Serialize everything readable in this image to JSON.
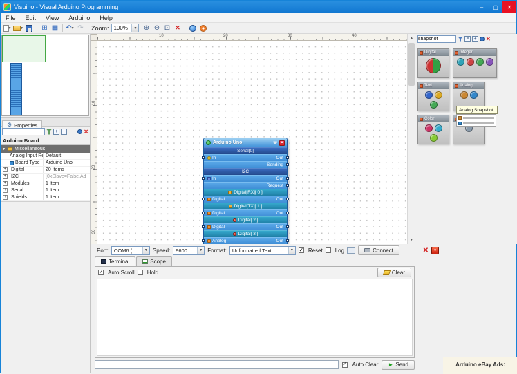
{
  "window": {
    "title": "Visuino - Visual Arduino Programming",
    "menu": [
      "File",
      "Edit",
      "View",
      "Arduino",
      "Help"
    ],
    "controls": {
      "minimize": "–",
      "maximize": "▢",
      "close": "✕"
    }
  },
  "toolbar": {
    "zoom_label": "Zoom:",
    "zoom_value": "100%"
  },
  "left_panel": {
    "properties_tab": "Properties",
    "board_title": "Arduino Board",
    "root_item": "Miscellaneous",
    "rows": [
      {
        "name": "Analog Input Refe.",
        "value": "Default"
      },
      {
        "name": "Board Type",
        "value": "Arduino Uno",
        "icon": "chip"
      },
      {
        "name": "Digital",
        "value": "20 Items",
        "expand": true
      },
      {
        "name": "I2C",
        "value": "[0xSlave=False,Ad",
        "expand": true,
        "muted": true
      },
      {
        "name": "Modules",
        "value": "1 Item",
        "expand": true
      },
      {
        "name": "Serial",
        "value": "1 Item",
        "expand": true
      },
      {
        "name": "Shields",
        "value": "1 Item",
        "expand": true
      }
    ]
  },
  "canvas": {
    "ruler_h": [
      "10",
      "20",
      "30",
      "40"
    ],
    "ruler_v": [
      "10",
      "20",
      "30"
    ],
    "component": {
      "title": "Arduino Uno",
      "rows": [
        {
          "type": "section",
          "text": "Serial[0]"
        },
        {
          "type": "pins",
          "left": "In",
          "right": "Out",
          "left_icon": "serial"
        },
        {
          "type": "pins",
          "right": "Sending"
        },
        {
          "type": "section",
          "text": "I2C"
        },
        {
          "type": "pins",
          "left": "In",
          "right": "Out",
          "left_icon": "i2c"
        },
        {
          "type": "pins",
          "right": "Request"
        },
        {
          "type": "channel",
          "text": "Digital[RX][ 0 ]",
          "icon": "chip"
        },
        {
          "type": "pins",
          "left": "Digital",
          "right": "Out",
          "left_icon": "digital"
        },
        {
          "type": "channel",
          "text": "Digital[TX][ 1 ]",
          "icon": "chip"
        },
        {
          "type": "pins",
          "left": "Digital",
          "right": "Out",
          "left_icon": "digital"
        },
        {
          "type": "channel",
          "text": "Digital[ 2 ]",
          "icon": "led"
        },
        {
          "type": "pins",
          "left": "Digital",
          "right": "Out",
          "left_icon": "digital"
        },
        {
          "type": "channel",
          "text": "Digital[ 3 ]",
          "icon": "led"
        },
        {
          "type": "pins",
          "left": "Analog",
          "right": "Out",
          "left_icon": "analog"
        }
      ]
    }
  },
  "palette": {
    "search_value": "snapshot",
    "tooltip": "Analog Snapshot",
    "boxes": [
      {
        "label": "Digital",
        "big": true,
        "icons": [
          "#cc3333",
          "#33a044"
        ]
      },
      {
        "label": "Integer",
        "wide": true,
        "icons": [
          "#2fa3b8",
          "#cc4444",
          "#44aa55",
          "#8855bb"
        ]
      },
      {
        "label": "Text",
        "icons": [
          "#3366cc",
          "#ddaa22",
          "#44aa55"
        ]
      },
      {
        "label": "Analog",
        "icons": [
          "#cc8833",
          "#3388cc"
        ]
      },
      {
        "label": "Color",
        "icons": [
          "#cc3366",
          "#33aacc",
          "#88cc33"
        ]
      },
      {
        "label": "",
        "icons": [
          "#8899aa"
        ]
      }
    ]
  },
  "connection": {
    "port_label": "Port:",
    "port_value": "COM6 (",
    "speed_label": "Speed:",
    "speed_value": "9600",
    "format_label": "Format:",
    "format_value": "Unformatted Text",
    "reset_label": "Reset",
    "log_label": "Log",
    "connect_label": "Connect"
  },
  "terminal": {
    "tabs": [
      "Terminal",
      "Scope"
    ],
    "auto_scroll_label": "Auto Scroll",
    "hold_label": "Hold",
    "clear_label": "Clear",
    "auto_clear_label": "Auto Clear",
    "send_label": "Send"
  },
  "footer": {
    "ads_label": "Arduino eBay Ads:"
  }
}
